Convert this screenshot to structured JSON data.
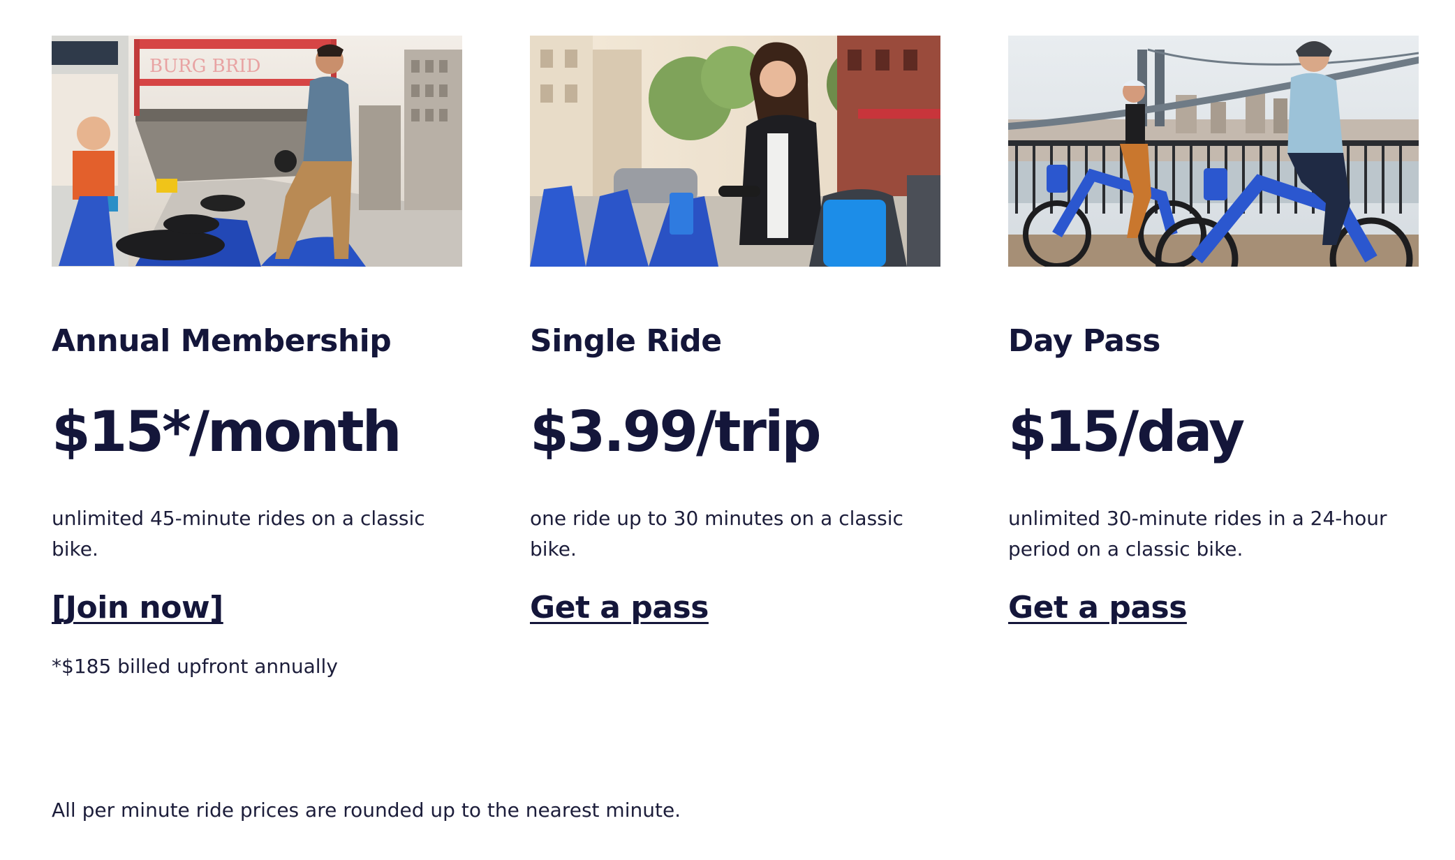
{
  "plans": [
    {
      "image_alt": "Man in denim jacket docking a blue Citi Bike at a station near the Williamsburg Bridge",
      "title": "Annual Membership",
      "price": "$15*/month",
      "description": "unlimited 45-minute rides on a classic bike.",
      "cta": "[Join now]",
      "note": "*$185 billed upfront annually"
    },
    {
      "image_alt": "Smiling woman in black leather jacket taking a Citi Bike from a docking station",
      "title": "Single Ride",
      "price": "$3.99/trip",
      "description": "one ride up to 30 minutes on a classic bike.",
      "cta": "Get a pass"
    },
    {
      "image_alt": "Two riders on blue Citi Bikes along the waterfront with the Manhattan Bridge behind",
      "title": "Day Pass",
      "price": "$15/day",
      "description": "unlimited 30-minute rides in a 24-hour period on a classic bike.",
      "cta": "Get a pass"
    }
  ],
  "footnote": "All per minute ride prices are rounded up to the nearest minute.",
  "colors": {
    "text": "#14163a",
    "citibike_blue": "#1f5bd8",
    "background": "#ffffff"
  }
}
